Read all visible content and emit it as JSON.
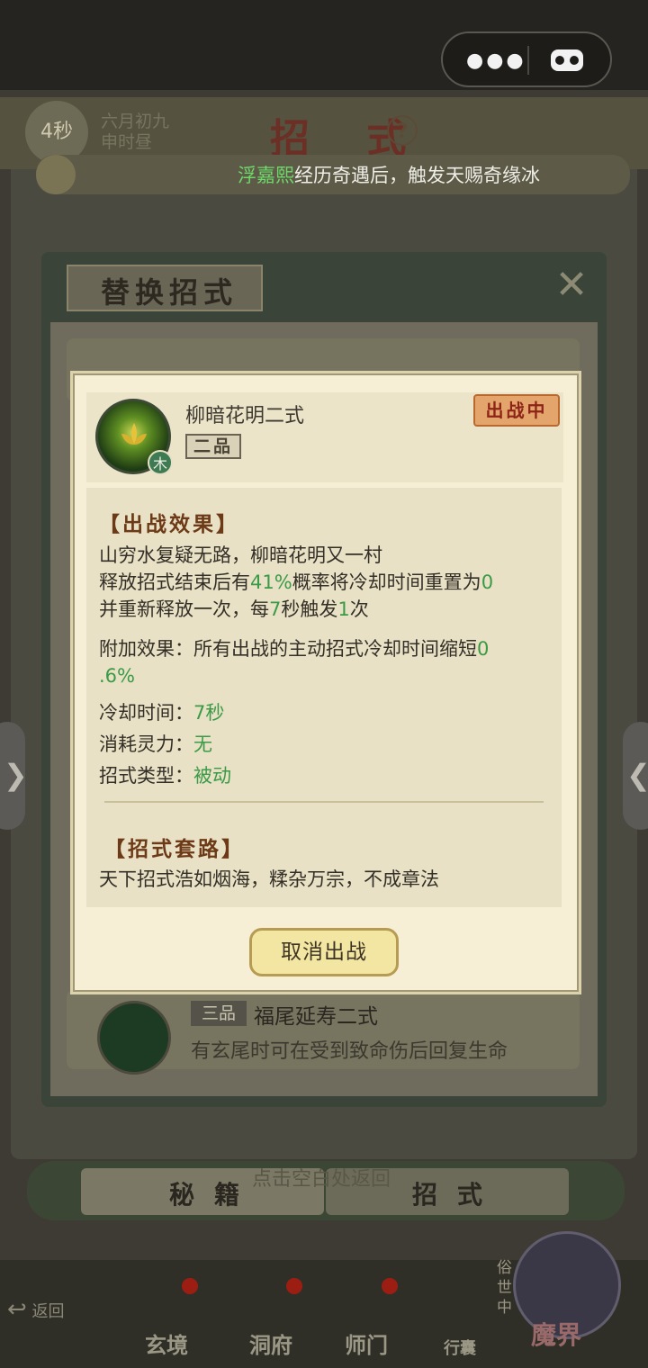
{
  "capsule": {
    "more_icon": "more-dots-icon",
    "game_icon": "gamepad-icon"
  },
  "header": {
    "timer": "4秒",
    "date_line1": "六月初九",
    "date_line2": "申时昼",
    "title": "招 式",
    "help_icon": "?"
  },
  "ticker": {
    "player_name": "浮嘉熙",
    "message": "经历奇遇后，触发天赐奇缘冰"
  },
  "panel": {
    "title": "替换招式",
    "close_icon": "close-cross-icon"
  },
  "background_list": {
    "item2": {
      "grade": "三品",
      "name": "福尾延寿二式",
      "desc": "有玄尾时可在受到致命伤后回复生命"
    }
  },
  "modal": {
    "skill_name": "柳暗花明二式",
    "grade": "二品",
    "element": "木",
    "status": "出战中",
    "effect_title": "【出战效果】",
    "effect": {
      "line1": "山穷水复疑无路，柳暗花明又一村",
      "line2_a": "释放招式结束后有",
      "line2_val": "41%",
      "line2_b": "概率将冷却时间重置为",
      "line2_val2": "0",
      "line3_a": "并重新释放一次，每",
      "line3_val": "7",
      "line3_b": "秒触发",
      "line3_val2": "1",
      "line3_c": "次"
    },
    "bonus": {
      "label": "附加效果：所有出战的主动招式冷却时间缩短",
      "val_a": "0",
      "val_b": ".6%"
    },
    "cooldown": {
      "label": "冷却时间：",
      "value": "7秒"
    },
    "cost": {
      "label": "消耗灵力：",
      "value": "无"
    },
    "type": {
      "label": "招式类型：",
      "value": "被动"
    },
    "routine_title": "【招式套路】",
    "routine_text": "天下招式浩如烟海，糅杂万宗，不成章法",
    "cancel_button": "取消出战"
  },
  "tabs": {
    "left": "秘籍",
    "right": "招式",
    "hint": "点击空白处返回"
  },
  "nav": {
    "back": "返回",
    "items": [
      "玄境",
      "洞府",
      "师门",
      "行囊"
    ],
    "world_side": "俗世中",
    "world": "魔界"
  },
  "colors": {
    "accent_green": "#3a9a46",
    "title_brown": "#6d3a18",
    "status_red": "#8e2418"
  }
}
